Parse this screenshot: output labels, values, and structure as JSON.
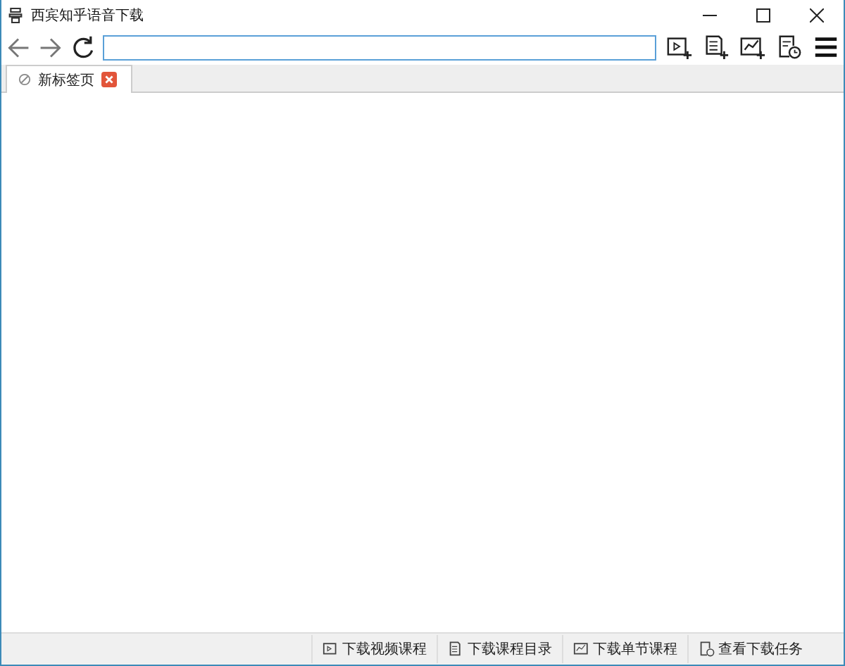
{
  "window": {
    "title": "西宾知乎语音下载"
  },
  "toolbar": {
    "tools": [
      {
        "kind": "video"
      },
      {
        "kind": "list"
      },
      {
        "kind": "chart"
      },
      {
        "kind": "clock"
      },
      {
        "kind": "menu"
      }
    ]
  },
  "tabs": [
    {
      "label": "新标签页",
      "selected": true
    }
  ],
  "status_bar": {
    "buttons": [
      {
        "kind": "video",
        "label": "下载视频课程"
      },
      {
        "kind": "list",
        "label": "下载课程目录"
      },
      {
        "kind": "chart",
        "label": "下载单节课程"
      },
      {
        "kind": "clock",
        "label": "查看下载任务"
      }
    ]
  }
}
